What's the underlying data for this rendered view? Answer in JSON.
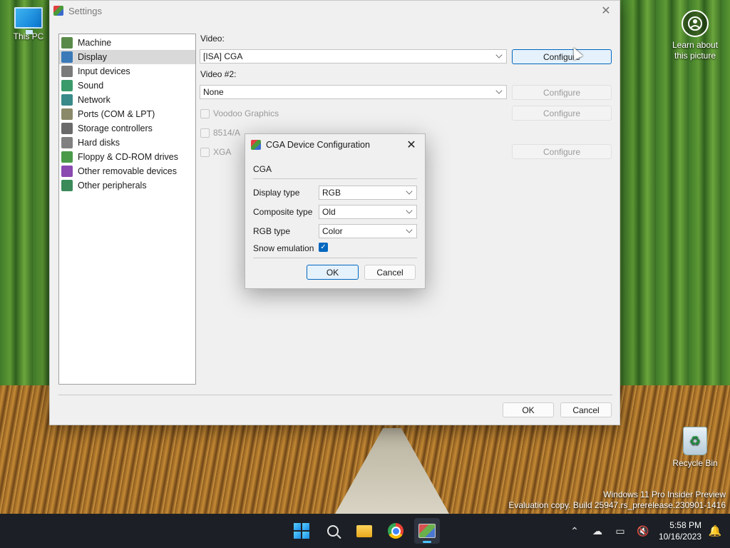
{
  "desktop": {
    "this_pc": "This PC",
    "recycle_bin": "Recycle Bin",
    "learn": [
      "Learn about",
      "this picture"
    ],
    "watermark": [
      "Windows 11 Pro Insider Preview",
      "Evaluation copy. Build 25947.rs_prerelease.230901-1416"
    ]
  },
  "settings": {
    "title": "Settings",
    "tree": [
      {
        "label": "Machine",
        "icon": "machine-icon",
        "color": "#5a8a4a"
      },
      {
        "label": "Display",
        "icon": "display-icon",
        "color": "#3a7ab8"
      },
      {
        "label": "Input devices",
        "icon": "input-devices-icon",
        "color": "#7a7a7a"
      },
      {
        "label": "Sound",
        "icon": "sound-icon",
        "color": "#3a9a6a"
      },
      {
        "label": "Network",
        "icon": "network-icon",
        "color": "#3a8a8a"
      },
      {
        "label": "Ports (COM & LPT)",
        "icon": "ports-icon",
        "color": "#8a8a6a"
      },
      {
        "label": "Storage controllers",
        "icon": "storage-controllers-icon",
        "color": "#6a6a6a"
      },
      {
        "label": "Hard disks",
        "icon": "hard-disks-icon",
        "color": "#808080"
      },
      {
        "label": "Floppy & CD-ROM drives",
        "icon": "floppy-cdrom-icon",
        "color": "#4a9a4a"
      },
      {
        "label": "Other removable devices",
        "icon": "removable-devices-icon",
        "color": "#8a4ab0"
      },
      {
        "label": "Other peripherals",
        "icon": "peripherals-icon",
        "color": "#3a8a5a"
      }
    ],
    "video_label": "Video:",
    "video_value": "[ISA] CGA",
    "video2_label": "Video #2:",
    "video2_value": "None",
    "configure": "Configure",
    "voodoo": "Voodoo Graphics",
    "ibm8514": "8514/A",
    "xga": "XGA",
    "ok": "OK",
    "cancel": "Cancel"
  },
  "dialog": {
    "title": "CGA Device Configuration",
    "group": "CGA",
    "display_type_label": "Display type",
    "display_type_value": "RGB",
    "composite_type_label": "Composite type",
    "composite_type_value": "Old",
    "rgb_type_label": "RGB type",
    "rgb_type_value": "Color",
    "snow_label": "Snow emulation",
    "snow_checked": true,
    "ok": "OK",
    "cancel": "Cancel"
  },
  "taskbar": {
    "time": "5:58 PM",
    "date": "10/16/2023"
  }
}
